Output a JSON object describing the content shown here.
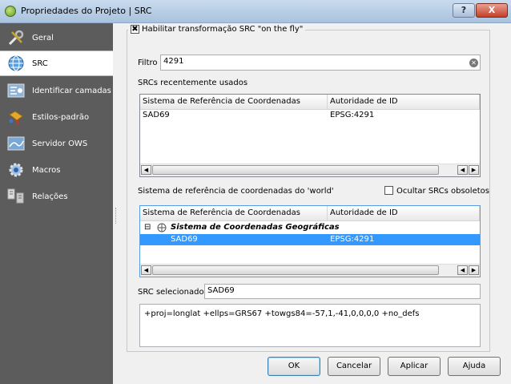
{
  "window": {
    "title": "Propriedades do Projeto | SRC",
    "help_label": "?",
    "close_label": "X"
  },
  "sidebar": {
    "items": [
      {
        "label": "Geral",
        "icon": "wrench-icon"
      },
      {
        "label": "SRC",
        "icon": "globe-icon"
      },
      {
        "label": "Identificar camadas",
        "icon": "identify-icon"
      },
      {
        "label": "Estilos-padrão",
        "icon": "paint-icon"
      },
      {
        "label": "Servidor OWS",
        "icon": "server-icon"
      },
      {
        "label": "Macros",
        "icon": "macro-gear-icon"
      },
      {
        "label": "Relações",
        "icon": "relations-icon"
      }
    ],
    "active_index": 1
  },
  "crs": {
    "otf_label": "Habilitar transformação SRC \"on the fly\"",
    "otf_checked": true,
    "filter_label": "Filtro",
    "filter_value": "4291",
    "recent_label": "SRCs recentemente usados",
    "recent_table": {
      "headers": [
        "Sistema de Referência de Coordenadas",
        "Autoridade de ID"
      ],
      "rows": [
        [
          "SAD69",
          "EPSG:4291"
        ]
      ]
    },
    "world_label": "Sistema de referência de coordenadas do 'world'",
    "hide_deprecated_label": "Ocultar SRCs obsoletos",
    "hide_deprecated_checked": false,
    "world_table": {
      "headers": [
        "Sistema de Referência de Coordenadas",
        "Autoridade de ID"
      ],
      "group": "Sistema de Coordenadas Geográficas",
      "expand_symbol": "⊟",
      "rows": [
        [
          "SAD69",
          "EPSG:4291"
        ]
      ]
    },
    "selected_label": "SRC selecionado:",
    "selected_value": "SAD69",
    "proj_string": "+proj=longlat +ellps=GRS67 +towgs84=-57,1,-41,0,0,0,0 +no_defs"
  },
  "buttons": {
    "ok": "OK",
    "cancel": "Cancelar",
    "apply": "Aplicar",
    "help": "Ajuda"
  },
  "colors": {
    "sidebar_bg": "#5c5c5c",
    "selection": "#3399ff"
  }
}
